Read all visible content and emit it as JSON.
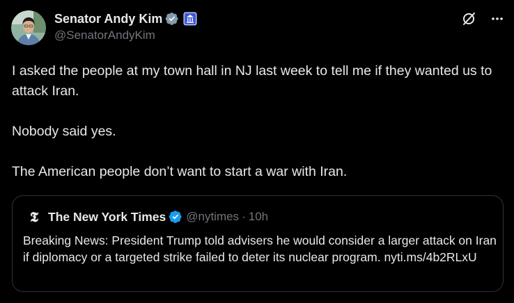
{
  "colors": {
    "background": "#000000",
    "text_primary": "#e7e9ea",
    "text_secondary": "#71767b",
    "verified_blue": "#1d9bf0",
    "verified_gray": "#829aab",
    "border": "#2f3336"
  },
  "tweet": {
    "author": {
      "name": "Senator Andy Kim",
      "handle": "@SenatorAndyKim",
      "avatar_icon": "avatar-photo",
      "badges": [
        "verified-gray-icon",
        "us-government-badge-icon"
      ]
    },
    "actions": {
      "grok_icon": "grok-icon",
      "more_icon": "more-options-icon"
    },
    "paragraphs": [
      "I asked the people at my town hall in NJ last week to tell me if they wanted us to attack Iran.",
      "Nobody said yes.",
      "The American people don’t want to start a war with Iran."
    ],
    "quote": {
      "name": "The New York Times",
      "handle": "@nytimes",
      "separator": "·",
      "time": "10h",
      "logo_text": "𝕿",
      "text": "Breaking News: President Trump told advisers he would consider a larger attack on Iran if diplomacy or a targeted strike failed to deter its nuclear program. nyti.ms/4b2RLxU"
    }
  }
}
